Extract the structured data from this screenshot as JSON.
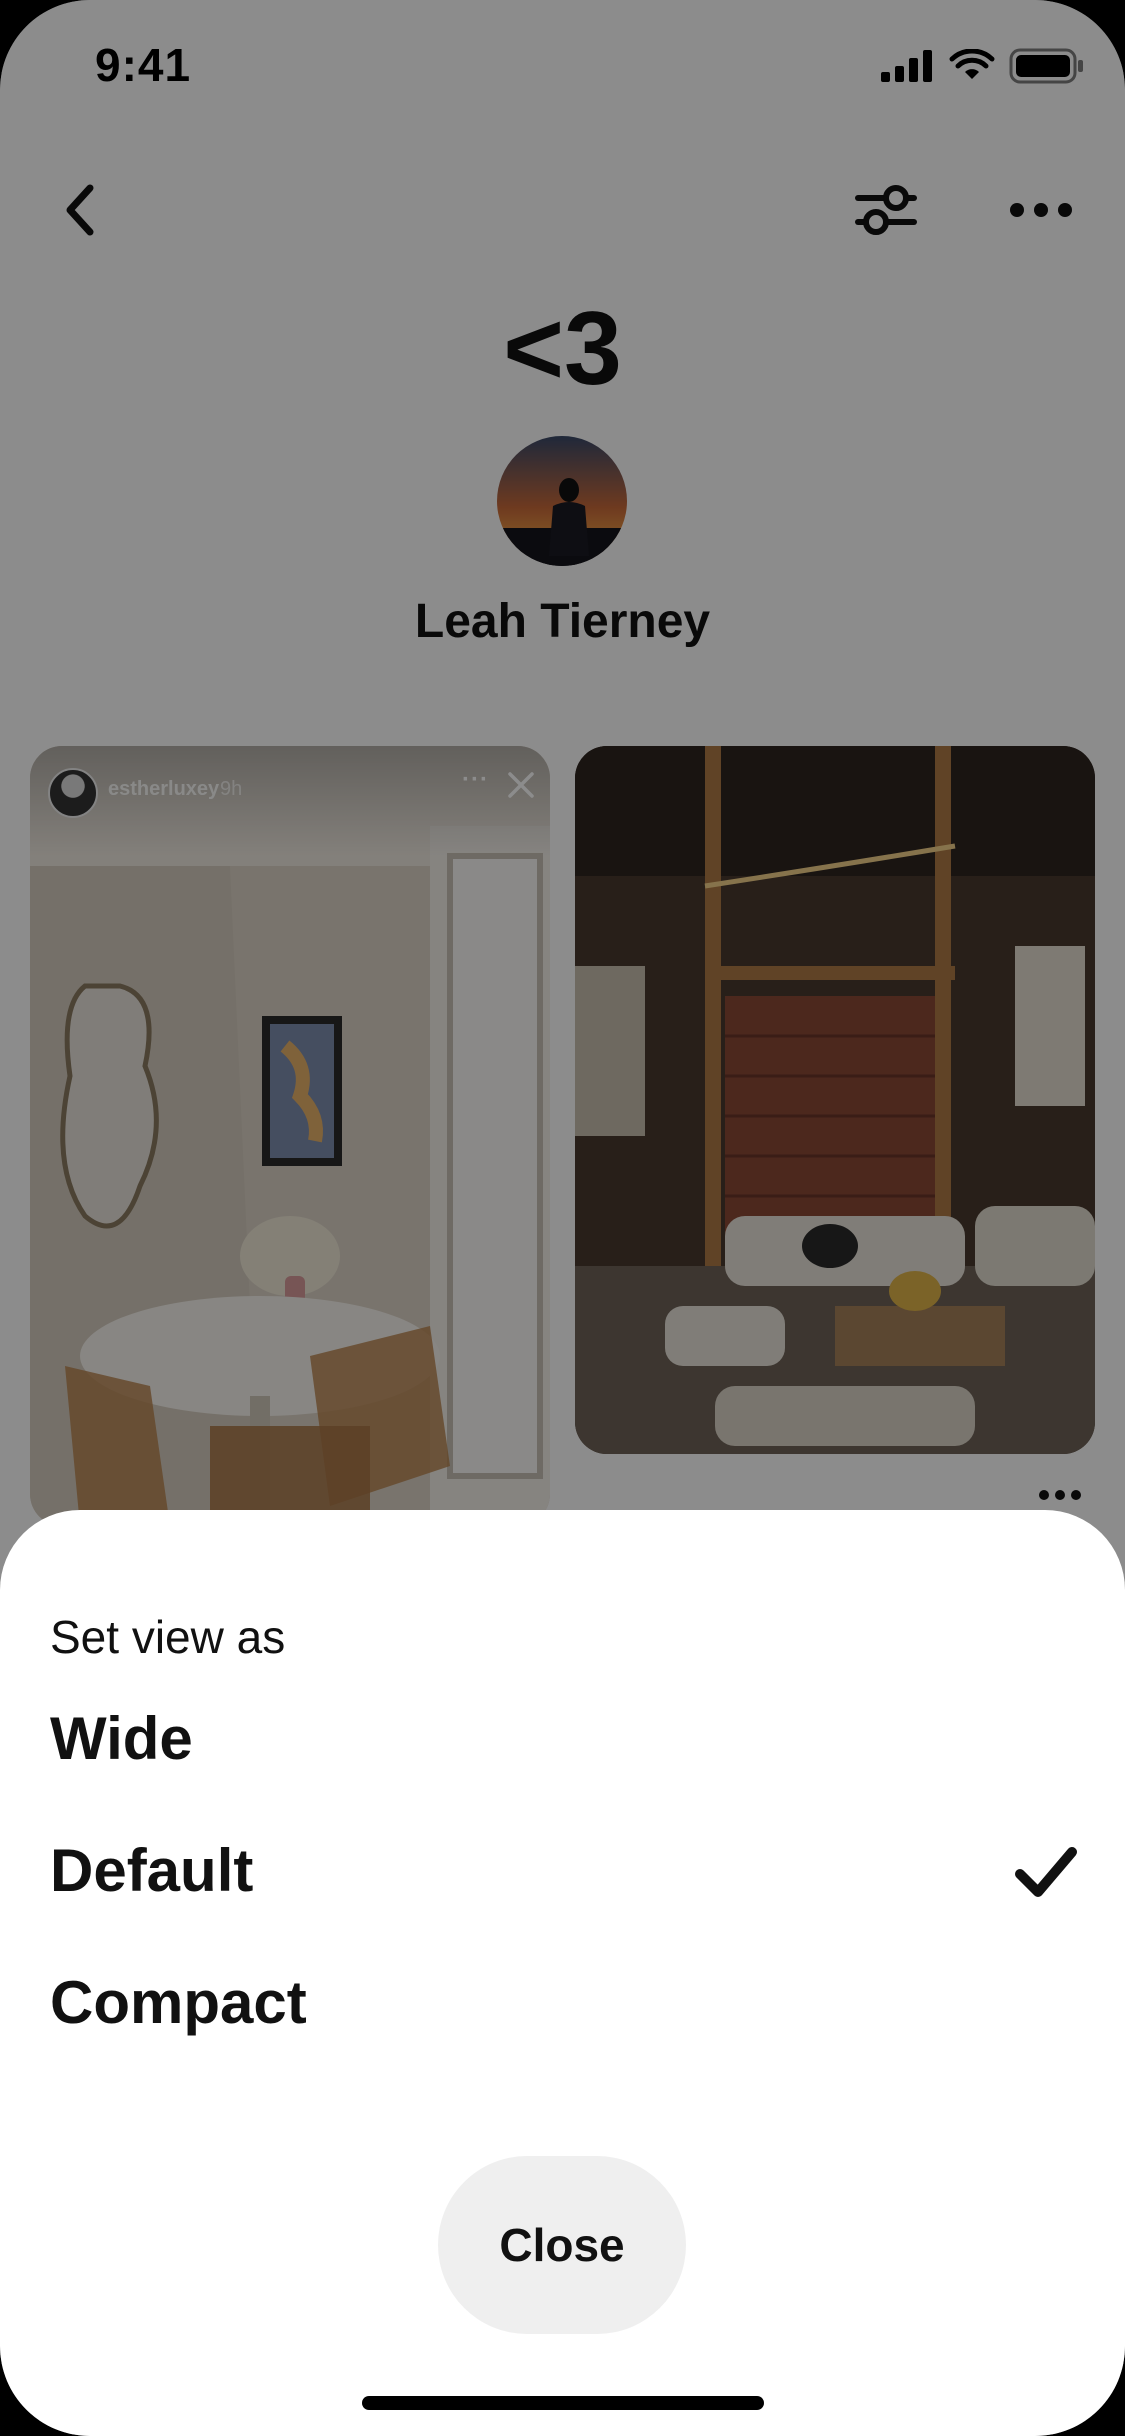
{
  "status_bar": {
    "time": "9:41"
  },
  "board": {
    "title": "<3",
    "owner_name": "Leah Tierney"
  },
  "pins": [
    {
      "story_user": "estherluxey",
      "story_time": "9h"
    }
  ],
  "sheet": {
    "title": "Set view as",
    "options": [
      {
        "label": "Wide",
        "selected": false
      },
      {
        "label": "Default",
        "selected": true
      },
      {
        "label": "Compact",
        "selected": false
      }
    ],
    "close_label": "Close"
  },
  "icons": {
    "back": "chevron-left-icon",
    "filter": "sliders-icon",
    "more": "ellipsis-icon",
    "check": "checkmark-icon"
  },
  "colors": {
    "text": "#111111",
    "sheet_background": "#ffffff",
    "close_button_background": "#efefef",
    "scrim": "rgba(0,0,0,0.45)"
  }
}
